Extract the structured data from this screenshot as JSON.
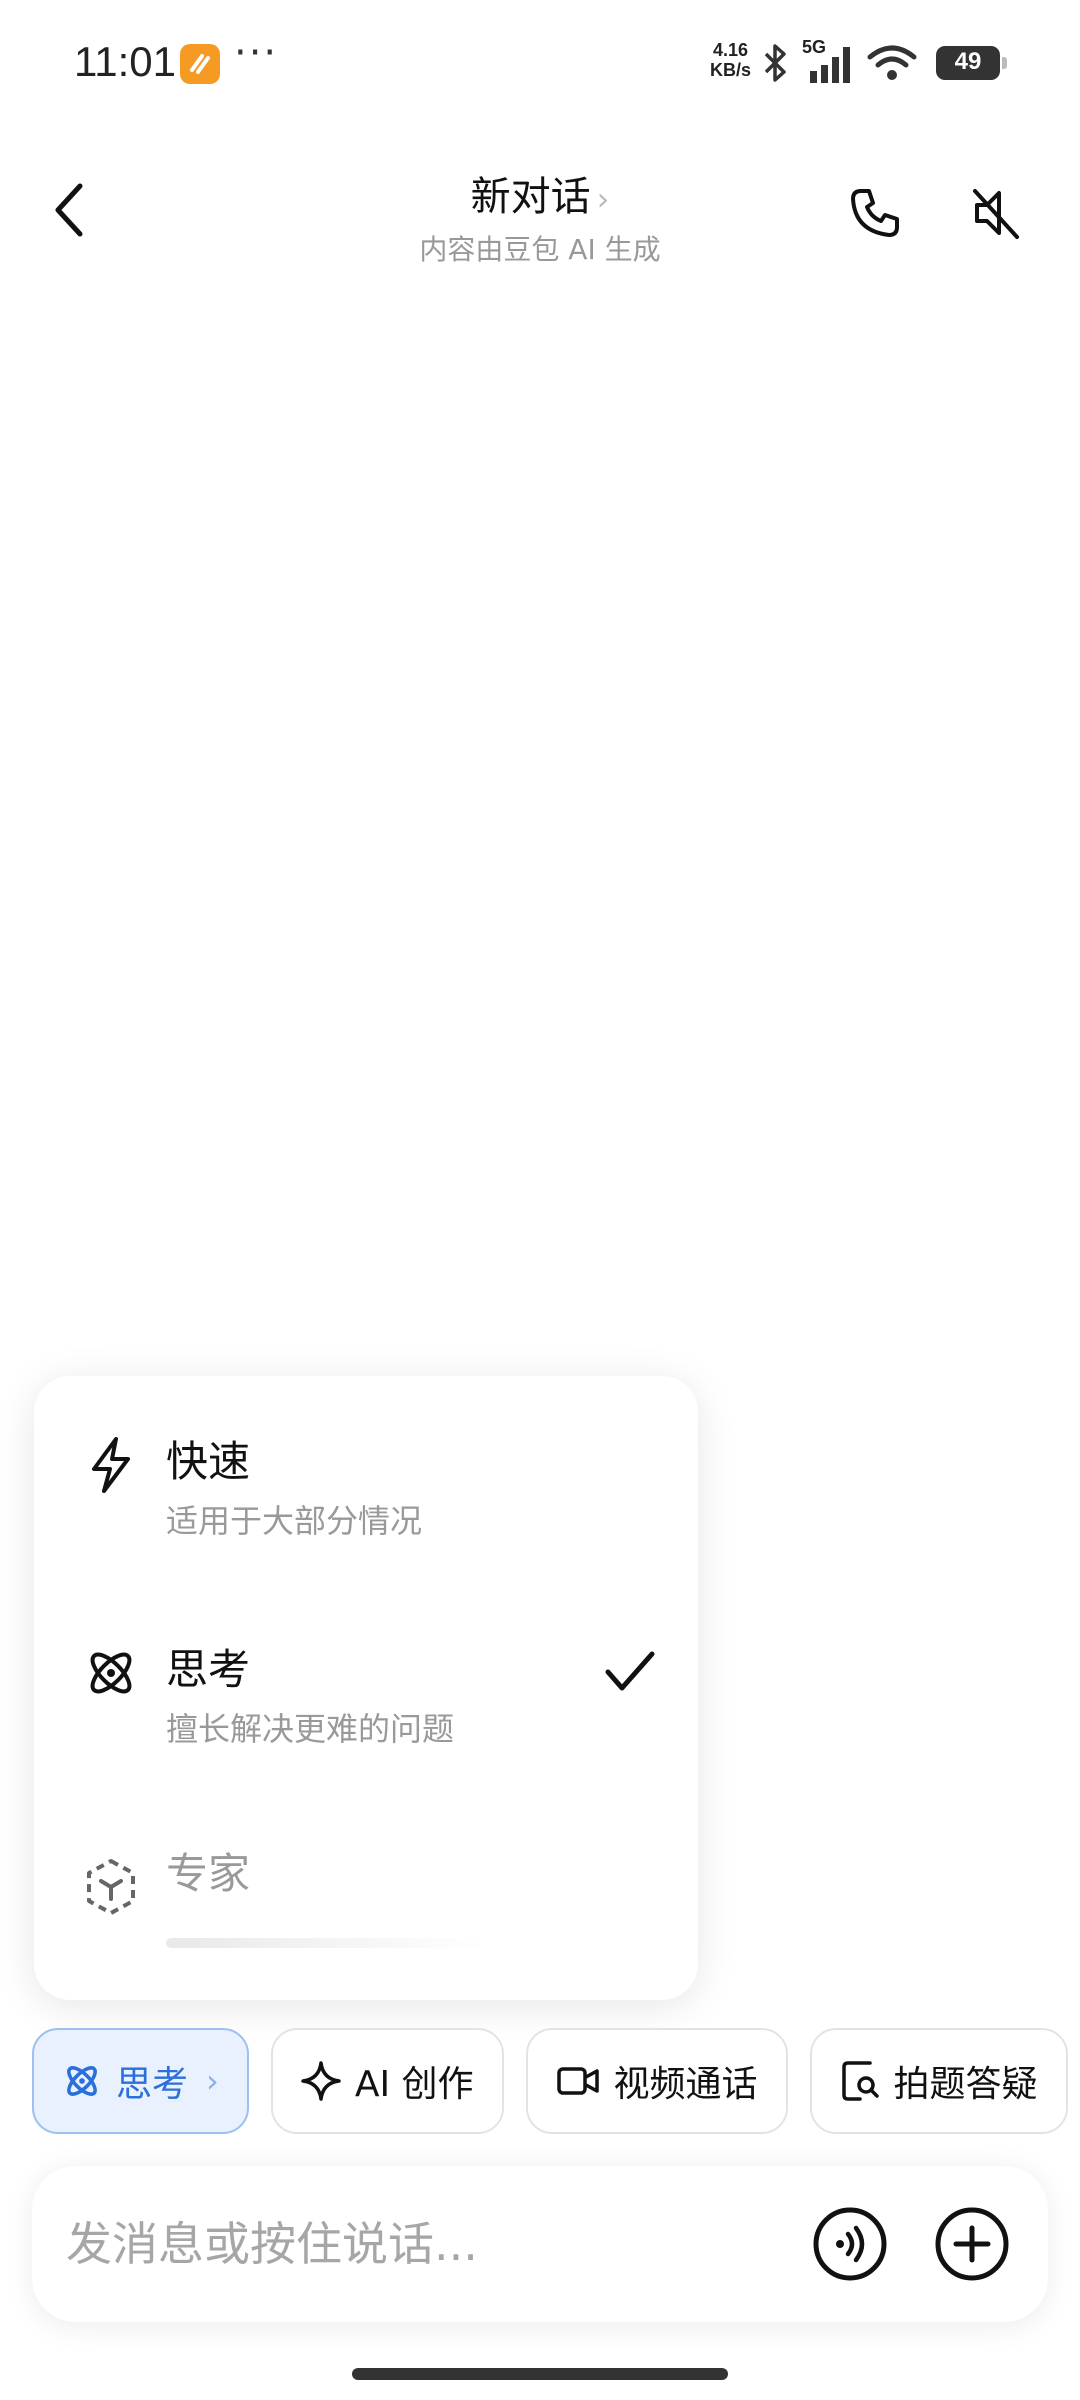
{
  "status_bar": {
    "time": "11:01",
    "more": "···",
    "net_speed_value": "4.16",
    "net_speed_unit": "KB/s",
    "network": "5G",
    "battery": "49"
  },
  "header": {
    "title": "新对话",
    "title_chevron": "›",
    "subtitle": "内容由豆包 AI 生成"
  },
  "mode_menu": {
    "items": [
      {
        "title": "快速",
        "desc": "适用于大部分情况",
        "icon": "lightning-icon",
        "selected": false
      },
      {
        "title": "思考",
        "desc": "擅长解决更难的问题",
        "icon": "atom-icon",
        "selected": true
      },
      {
        "title": "专家",
        "desc": "",
        "icon": "cube-icon",
        "selected": false
      }
    ],
    "check_symbol": "✓"
  },
  "chips": [
    {
      "label": "思考",
      "icon": "atom-icon",
      "active": true,
      "chevron": "›"
    },
    {
      "label": "AI 创作",
      "icon": "sparkle-icon",
      "active": false
    },
    {
      "label": "视频通话",
      "icon": "video-camera-icon",
      "active": false
    },
    {
      "label": "拍题答疑",
      "icon": "photo-search-icon",
      "active": false
    }
  ],
  "input": {
    "placeholder": "发消息或按住说话...",
    "value": ""
  },
  "colors": {
    "accent": "#2a6fdb",
    "chip_active_bg": "#e8f1fd",
    "muted_text": "#999999"
  }
}
